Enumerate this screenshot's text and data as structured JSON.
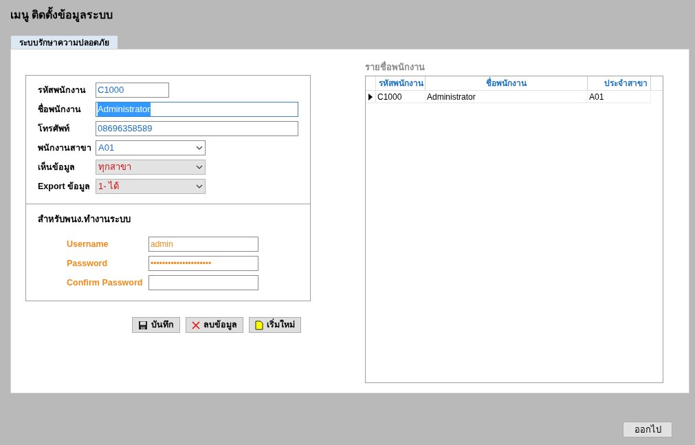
{
  "window": {
    "title": "เมนู ติดตั้งข้อมูลระบบ"
  },
  "tabs": [
    {
      "label": "ระบบรักษาความปลอดภัย",
      "selected": true
    }
  ],
  "employee_form": {
    "fields": [
      {
        "kind": "short_text",
        "label": "รหัสพนักงาน",
        "value": "C1000",
        "highlighted": false
      },
      {
        "kind": "long_text",
        "label": "ชื่อพนักงาน",
        "value": "Administrator",
        "highlighted": true
      },
      {
        "kind": "long_text",
        "label": "โทรศัพท์",
        "value": "08696358589",
        "highlighted": false
      },
      {
        "kind": "select",
        "label": "พนักงานสาขา",
        "value": "A01",
        "disabled": false
      },
      {
        "kind": "select",
        "label": "เห็นข้อมูล",
        "value": "ทุกสาขา",
        "disabled": true
      },
      {
        "kind": "select",
        "label": "Export ข้อมูล",
        "value": "1- ได้",
        "disabled": true
      }
    ]
  },
  "login_section": {
    "title": "สำหรับพนง.ทำงานระบบ",
    "fields": [
      {
        "label": "Username",
        "value": "admin"
      },
      {
        "label": "Password",
        "value": "•••••••••••••••••••••"
      },
      {
        "label": "Confirm Password"
      }
    ]
  },
  "buttons": [
    {
      "kind": "save",
      "label": "บันทึก"
    },
    {
      "kind": "delete",
      "label": "ลบข้อมูล"
    },
    {
      "kind": "new",
      "label": "เริ่มใหม่"
    }
  ],
  "employee_list": {
    "title": "รายชื่อพนักงาน",
    "columns": [
      "รหัสพนักงาน",
      "ชื่อพนักงาน",
      "ประจำสาขา"
    ],
    "rows": [
      {
        "cells": [
          "C1000",
          "Administrator",
          "A01"
        ],
        "selected": true
      }
    ]
  },
  "exit_button": {
    "label": "ออกไป"
  }
}
